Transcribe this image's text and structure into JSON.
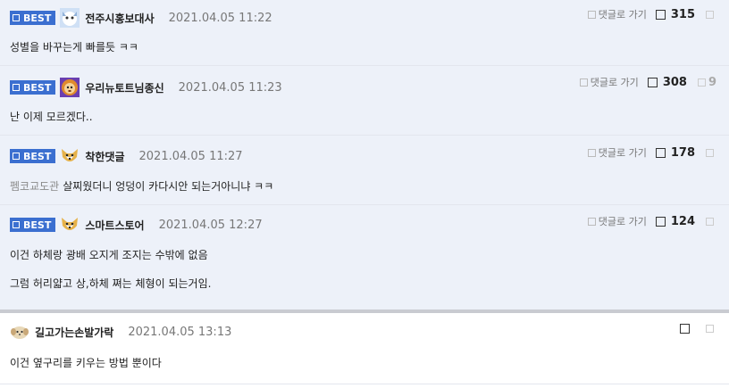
{
  "comments": [
    {
      "best_label": "BEST",
      "author": "전주시홍보대사",
      "date": "2021.04.05 11:22",
      "reply_label": "댓글로 가기",
      "votes": "315",
      "downvotes": "",
      "lines": [
        "성별을 바꾸는게 빠를듯 ㅋㅋ"
      ]
    },
    {
      "best_label": "BEST",
      "author": "우리뉴토트님종신",
      "date": "2021.04.05 11:23",
      "reply_label": "댓글로 가기",
      "votes": "308",
      "downvotes": "9",
      "lines": [
        "난 이제 모르겠다.."
      ]
    },
    {
      "best_label": "BEST",
      "author": "착한댓글",
      "date": "2021.04.05 11:27",
      "reply_label": "댓글로 가기",
      "votes": "178",
      "downvotes": "",
      "prefix": "펨코교도관",
      "lines": [
        "살찌웠더니 엉덩이 카다시안 되는거아니냐 ㅋㅋ"
      ]
    },
    {
      "best_label": "BEST",
      "author": "스마트스토어",
      "date": "2021.04.05 12:27",
      "reply_label": "댓글로 가기",
      "votes": "124",
      "downvotes": "",
      "lines": [
        "이건 하체랑 광배 오지게 조지는 수밖에 없음",
        "그럼 허리얇고 상,하체 쪄는 체형이 되는거임."
      ]
    },
    {
      "author": "길고가는손발가락",
      "date": "2021.04.05 13:13",
      "votes": "",
      "downvotes": "",
      "lines": [
        "이건 옆구리를 키우는 방법 뿐이다"
      ]
    }
  ],
  "colors": {
    "best_badge": "#3b6fd0",
    "best_bg": "#edf1f9",
    "separator": "#c9cbd1"
  }
}
